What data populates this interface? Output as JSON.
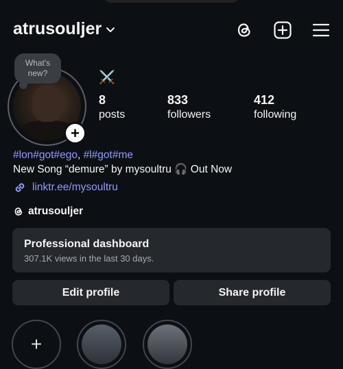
{
  "header": {
    "username": "atrusouljer",
    "icons": [
      "threads-icon",
      "create-icon",
      "menu-icon"
    ]
  },
  "note_bubble": {
    "line1": "What's",
    "line2": "new?"
  },
  "profile": {
    "emoji": "⚔️",
    "stats": [
      {
        "value": "8",
        "label": "posts"
      },
      {
        "value": "833",
        "label": "followers"
      },
      {
        "value": "412",
        "label": "following"
      }
    ]
  },
  "bio": {
    "hashtag1": "#lon#got#ego",
    "separator": ", ",
    "hashtag2": "#l#got#me",
    "line2": "New Song “demure” by mysoultru 🎧 Out Now",
    "link": "linktr.ee/mysoultru",
    "threads_handle": "atrusouljer"
  },
  "dashboard": {
    "title": "Professional dashboard",
    "subtitle": "307.1K views in the last 30 days."
  },
  "buttons": {
    "edit": "Edit profile",
    "share": "Share profile"
  }
}
